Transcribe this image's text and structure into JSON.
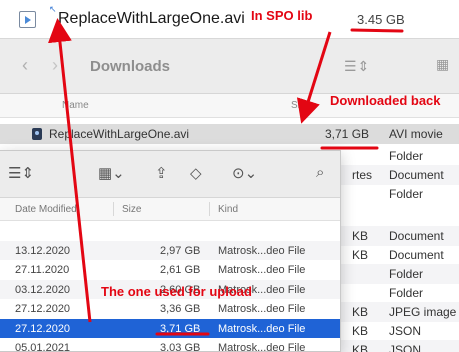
{
  "spo": {
    "file_name": "ReplaceWithLargeOne.avi",
    "file_size": "3.45 GB"
  },
  "downloads_window": {
    "title": "Downloads",
    "columns": {
      "name": "Name",
      "size": "Size"
    },
    "rows": [
      {
        "name": "ReplaceWithLargeOne.avi",
        "size": "3,71 GB",
        "kind": "AVI movie",
        "selected": true
      },
      {
        "size_frag": "",
        "kind": "Folder"
      },
      {
        "size_frag": "rtes",
        "kind": "Document"
      },
      {
        "size_frag": "",
        "kind": "Folder"
      },
      {
        "size_frag": "KB",
        "kind": "Document"
      },
      {
        "size_frag": "KB",
        "kind": "Document"
      },
      {
        "size_frag": "",
        "kind": "Folder"
      },
      {
        "size_frag": "",
        "kind": "Folder"
      },
      {
        "size_frag": "KB",
        "kind": "JPEG image"
      },
      {
        "size_frag": "KB",
        "kind": "JSON"
      },
      {
        "size_frag": "KB",
        "kind": "JSON"
      }
    ]
  },
  "front_window": {
    "columns": {
      "date": "Date Modified",
      "size": "Size",
      "kind": "Kind"
    },
    "rows": [
      {
        "date": "",
        "size": "",
        "kind": ""
      },
      {
        "date": "13.12.2020",
        "size": "2,97 GB",
        "kind": "Matrosk...deo File"
      },
      {
        "date": "27.11.2020",
        "size": "2,61 GB",
        "kind": "Matrosk...deo File"
      },
      {
        "date": "03.12.2020",
        "size": "2,60 GB",
        "kind": "Matrosk...deo File"
      },
      {
        "date": "27.12.2020",
        "size": "3,36 GB",
        "kind": "Matrosk...deo File"
      },
      {
        "date": "27.12.2020",
        "size": "3,71 GB",
        "kind": "Matrosk...deo File",
        "selected": true
      },
      {
        "date": "05.01.2021",
        "size": "3,03 GB",
        "kind": "Matrosk...deo File"
      }
    ]
  },
  "annotations": {
    "in_spo": "In SPO lib",
    "downloaded_back": "Downloaded back",
    "used_for_upload": "The one used for upload",
    "color": "#e30613"
  },
  "icons": {
    "spo_file": "video-file-icon",
    "back": "chevron-left-icon",
    "forward": "chevron-right-icon",
    "list_view": "list-view-icon",
    "grid_view": "grid-view-icon",
    "share": "share-icon",
    "tag": "tag-icon",
    "more": "more-icon",
    "search": "search-icon"
  }
}
